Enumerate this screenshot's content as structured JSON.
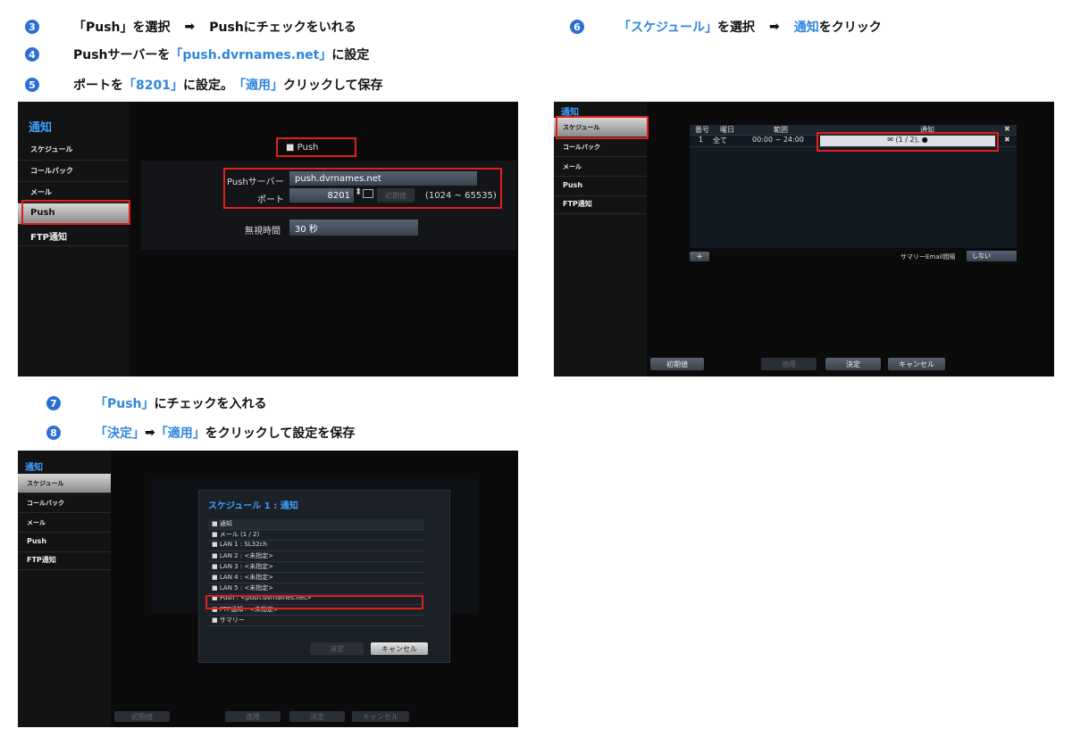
{
  "instructions": {
    "s3": {
      "num": "3",
      "p1": "「Push」を選択",
      "arrow": "➡",
      "p2": "Pushにチェックをいれる"
    },
    "s4": {
      "num": "4",
      "p1": "Pushサーバーを",
      "p2": "「push.dvrnames.net」",
      "p3": "に設定"
    },
    "s5": {
      "num": "5",
      "p1": "ポートを",
      "p2": "「8201」",
      "p3": "に設定。",
      "p4": "「適用」",
      "p5": "クリックして保存"
    },
    "s6": {
      "num": "6",
      "p1": "「スケジュール」",
      "p2": "を選択",
      "arrow": "➡",
      "p3": "通知",
      "p4": "をクリック"
    },
    "s7": {
      "num": "7",
      "p1": "「Push」",
      "p2": "にチェックを入れる"
    },
    "s8": {
      "num": "8",
      "p1": "「決定」",
      "arrow": "➡",
      "p2": "「適用」",
      "p3": "をクリックして設定を保存"
    }
  },
  "sidebar": {
    "title": "通知",
    "items": [
      "スケジュール",
      "コールバック",
      "メール",
      "Push",
      "FTP通知"
    ]
  },
  "screen1": {
    "push_label": "Push",
    "server_label": "Pushサーバー",
    "server_value": "push.dvrnames.net",
    "port_label": "ポート",
    "port_value": "8201",
    "default_btn": "初期値",
    "port_range": "(1024 ~ 65535)",
    "ignore_label": "無視時間",
    "ignore_value": "30 秒"
  },
  "screen2": {
    "headers": [
      "番号",
      "曜日",
      "範囲",
      "通知"
    ],
    "row": {
      "no": "1",
      "day": "全て",
      "range": "00:00 ~ 24:00",
      "notify": "✉ (1 / 2), ●"
    },
    "add": "+",
    "summary_label": "サマリーEmail間隔",
    "summary_value": "しない",
    "btn_default": "初期値",
    "btn_apply": "適用",
    "btn_ok": "決定",
    "btn_cancel": "キャンセル"
  },
  "screen3": {
    "dialog_title": "スケジュール 1 : 通知",
    "list": [
      "通知",
      "メール (1 / 2)",
      "LAN 1 : SL32ch",
      "LAN 2 : <未指定>",
      "LAN 3 : <未指定>",
      "LAN 4 : <未指定>",
      "LAN 5 : <未指定>",
      "Push : <push.dvrnames.net>",
      "FTP通知 : <未指定>",
      "サマリー"
    ],
    "dlg_ok": "決定",
    "dlg_cancel": "キャンセル",
    "btn_default": "初期値",
    "btn_apply": "適用",
    "btn_ok": "決定",
    "btn_cancel": "キャンセル"
  },
  "colors": {
    "accent_blue": "#2e86de",
    "highlight_red": "#e0201c",
    "screen_bg": "#0b0b0b"
  }
}
